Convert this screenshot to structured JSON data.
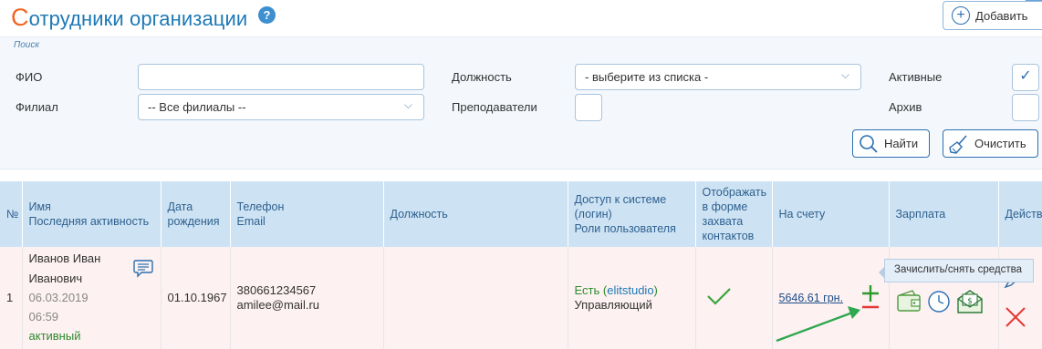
{
  "header": {
    "title_first": "С",
    "title_rest": "отрудники организации",
    "help": "?",
    "add_label": "Добавить"
  },
  "filter": {
    "title": "Поиск",
    "fio_label": "ФИО",
    "fio_value": "",
    "branch_label": "Филиал",
    "branch_value": "-- Все филиалы --",
    "position_label": "Должность",
    "position_value": "- выберите из списка -",
    "teachers_label": "Преподаватели",
    "active_label": "Активные",
    "active_checked": true,
    "archive_label": "Архив",
    "archive_checked": false,
    "find_label": "Найти",
    "clear_label": "Очистить"
  },
  "table": {
    "headers": {
      "num": "№",
      "name_1": "Имя",
      "name_2": "Последняя активность",
      "dob_1": "Дата",
      "dob_2": "рождения",
      "phone_1": "Телефон",
      "phone_2": "Email",
      "position": "Должность",
      "access_1": "Доступ к системе",
      "access_2": "(логин)",
      "access_3": "Роли пользователя",
      "capture_1": "Отображать",
      "capture_2": "в форме",
      "capture_3": "захвата",
      "capture_4": "контактов",
      "balance": "На счету",
      "salary": "Зарплата",
      "actions": "Действия"
    },
    "rows": [
      {
        "num": "1",
        "name_1": "Иванов Иван",
        "name_2": "Иванович",
        "last_date": "06.03.2019",
        "last_time": "06:59",
        "status": "активный",
        "dob": "01.10.1967",
        "phone": "380661234567",
        "email": "amilee@mail.ru",
        "position": "",
        "access": "Есть",
        "login": "elitstudio",
        "role": "Управляющий",
        "balance": "5646.61 грн.",
        "tooltip": "Зачислить/снять средства"
      }
    ]
  },
  "colors": {
    "accent_blue": "#1e79b5",
    "title_orange": "#f26522",
    "header_bg": "#cde3f4",
    "row_bg": "#fdf1f1",
    "green": "#2e8b2e",
    "red": "#e53935"
  }
}
